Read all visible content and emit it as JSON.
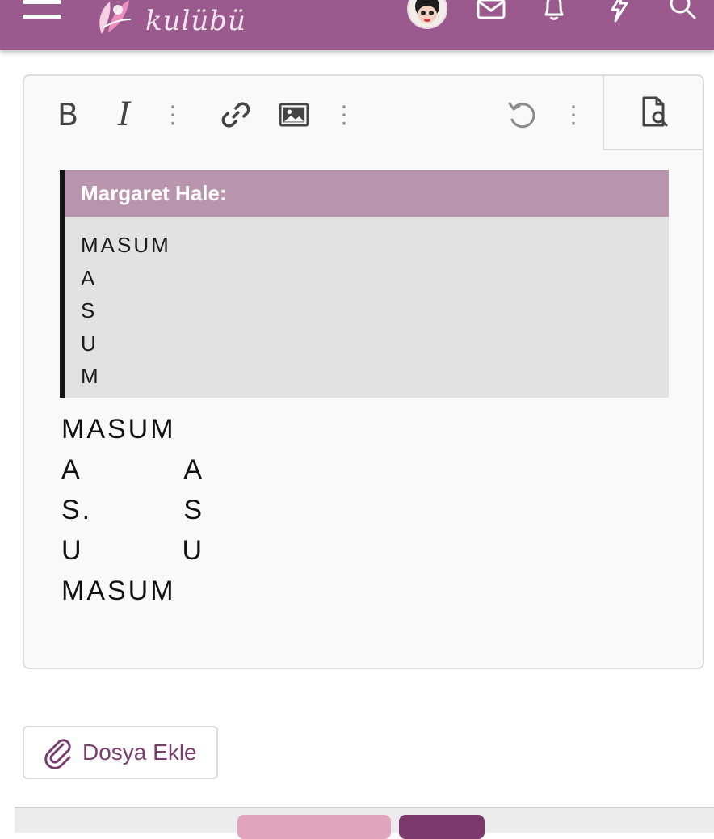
{
  "header": {
    "logo_text": "kulübü",
    "icons": [
      "menu-icon",
      "logo-icon",
      "avatar",
      "envelope-icon",
      "bell-icon",
      "bolt-icon",
      "search-icon"
    ],
    "brand_color": "#9b5a8e"
  },
  "toolbar": {
    "bold_label": "B",
    "italic_label": "I",
    "more_label": "⋮",
    "icons": [
      "link-icon",
      "image-icon",
      "undo-icon",
      "preview-icon"
    ]
  },
  "quote": {
    "author": "Margaret Hale:",
    "lines": [
      "MASUM",
      "A",
      "S",
      "U",
      "M"
    ]
  },
  "poem": {
    "lines": [
      {
        "left": "MASUM",
        "right": ""
      },
      {
        "left": "A",
        "right": "A"
      },
      {
        "left": "S.",
        "right": "S"
      },
      {
        "left": "U",
        "right": "U"
      },
      {
        "left": "MASUM",
        "right": ""
      }
    ]
  },
  "attach": {
    "label": "Dosya Ekle"
  }
}
